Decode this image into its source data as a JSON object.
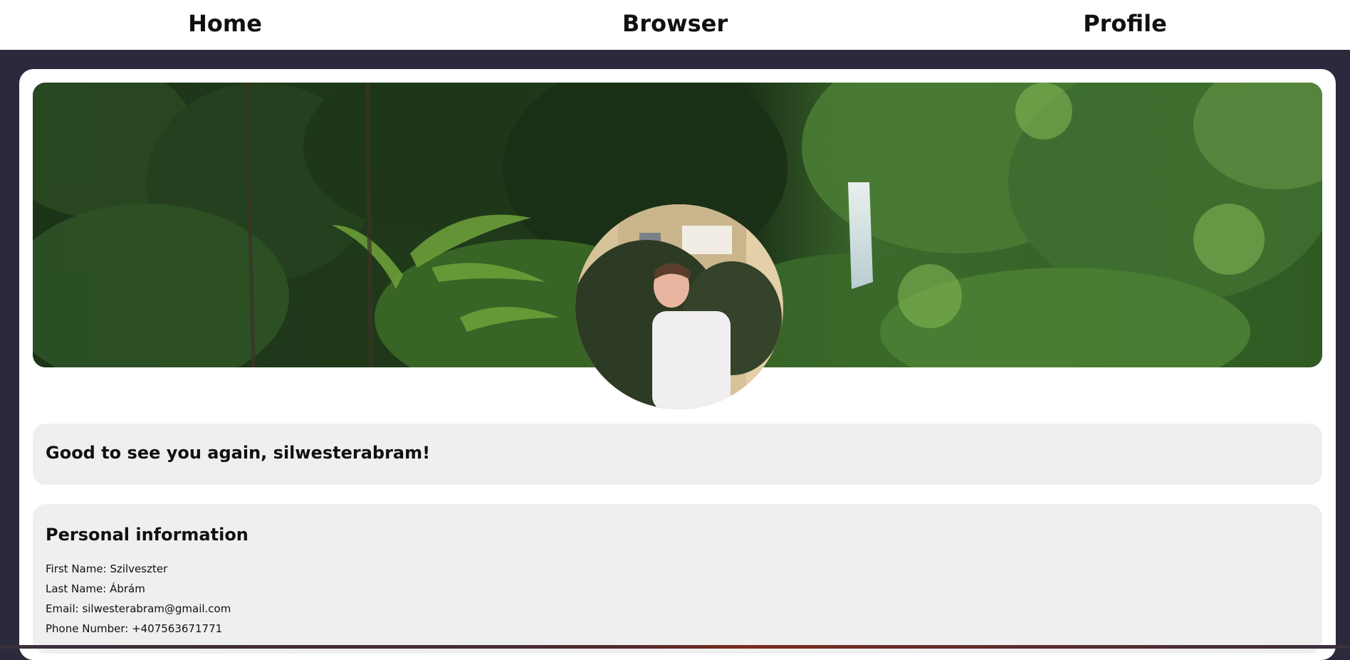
{
  "nav": {
    "items": [
      {
        "label": "Home"
      },
      {
        "label": "Browser"
      },
      {
        "label": "Profile"
      }
    ]
  },
  "greeting": {
    "text": "Good to see you again, silwesterabram!"
  },
  "personal_info": {
    "heading": "Personal information",
    "first_name_label": "First Name:",
    "first_name": "Szilveszter",
    "last_name_label": "Last Name:",
    "last_name": "Ábrám",
    "email_label": "Email:",
    "email": "silwesterabram@gmail.com",
    "phone_label": "Phone Number:",
    "phone": "+407563671771"
  },
  "colors": {
    "page_background": "#2b2a3c",
    "nav_background": "#ffffff",
    "card_background": "#ffffff",
    "panel_background": "#efefef"
  }
}
